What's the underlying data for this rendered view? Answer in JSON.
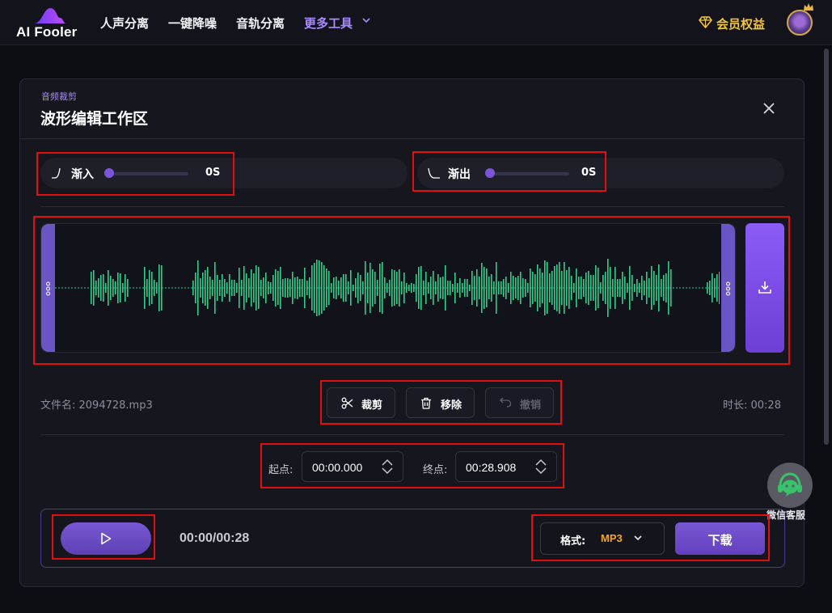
{
  "nav": {
    "logo_text": "AI Fooler",
    "links": [
      "人声分离",
      "一键降噪",
      "音轨分离",
      "更多工具"
    ],
    "vip_label": "会员权益"
  },
  "panel": {
    "subtitle": "音频裁剪",
    "title": "波形编辑工作区",
    "fade_in": {
      "label": "渐入",
      "value": "0S",
      "level": 0
    },
    "fade_out": {
      "label": "渐出",
      "value": "0S",
      "level": 0
    },
    "file_name": "文件名: 2094728.mp3",
    "duration": "时长: 00:28",
    "tools": {
      "cut": "裁剪",
      "remove": "移除",
      "undo": "撤销"
    },
    "start_label": "起点:",
    "start_value": "00:00.000",
    "end_label": "终点:",
    "end_value": "00:28.908"
  },
  "player": {
    "time": "00:00/00:28",
    "format_label": "格式:",
    "format_value": "MP3",
    "download_label": "下载"
  },
  "wechat": {
    "label": "微信客服"
  },
  "colors": {
    "accent": "#7858d4",
    "wave": "#2ed18a",
    "vip": "#f3c53f",
    "format": "#f5a623",
    "highlight": "#e01010"
  }
}
